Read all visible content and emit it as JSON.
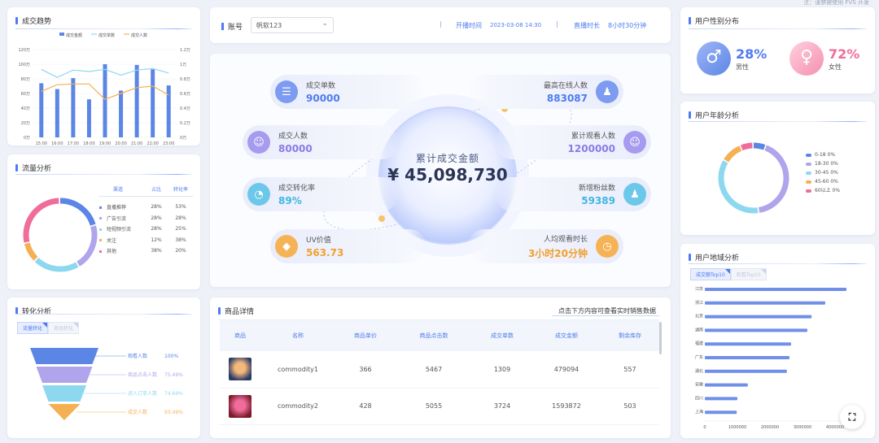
{
  "note": "注：谨禁被使用 FVS 开发",
  "trend": {
    "title": "成交趋势",
    "legend": [
      "成交金额",
      "成交单数",
      "成交人数"
    ],
    "yleft": [
      "120万",
      "100万",
      "80万",
      "60万",
      "40万",
      "20万",
      "0万"
    ],
    "yright": [
      "1.2万",
      "1万",
      "0.8万",
      "0.6万",
      "0.4万",
      "0.2万",
      "0万"
    ],
    "x": [
      "15:00",
      "16:00",
      "17:00",
      "18:00",
      "19:00",
      "20:00",
      "21:00",
      "22:00",
      "23:00"
    ]
  },
  "chart_data": [
    {
      "type": "bar",
      "title": "成交趋势",
      "categories": [
        "15:00",
        "16:00",
        "17:00",
        "18:00",
        "19:00",
        "20:00",
        "21:00",
        "22:00",
        "23:00"
      ],
      "series": [
        {
          "name": "成交金额",
          "type": "bar",
          "values": [
            74,
            66,
            81,
            52,
            100,
            64,
            99,
            93,
            71
          ]
        },
        {
          "name": "成交单数",
          "type": "line",
          "values": [
            0.93,
            0.82,
            0.92,
            0.9,
            0.93,
            0.85,
            0.92,
            0.94,
            0.88
          ]
        },
        {
          "name": "成交人数",
          "type": "line",
          "values": [
            0.63,
            0.72,
            0.73,
            0.73,
            0.52,
            0.6,
            0.68,
            0.7,
            0.58
          ]
        }
      ],
      "ylim_left": [
        0,
        120
      ],
      "ylim_right": [
        0,
        1.2
      ]
    },
    {
      "type": "pie",
      "title": "流量分析",
      "categories": [
        "直播推荐",
        "广告引流",
        "短视频引流",
        "关注",
        "其他"
      ],
      "values": [
        28,
        28,
        28,
        12,
        38
      ],
      "colors": [
        "#5b86e5",
        "#b0a4ec",
        "#8ed8ef",
        "#f6b054",
        "#f06c9b"
      ]
    },
    {
      "type": "pie",
      "title": "用户年龄分析",
      "categories": [
        "0-18",
        "18-30",
        "30-45",
        "45-60",
        "60以上"
      ],
      "values": [
        6,
        42,
        36,
        10,
        6
      ],
      "colors": [
        "#5b86e5",
        "#b0a4ec",
        "#8ed8ef",
        "#f6b054",
        "#f06c9b"
      ]
    },
    {
      "type": "bar",
      "title": "用户地域分析",
      "categories": [
        "江苏",
        "浙江",
        "北京",
        "湖南",
        "福建",
        "广东",
        "湖北",
        "安徽",
        "四川",
        "上海"
      ],
      "values": [
        4350000,
        3700000,
        3280000,
        3150000,
        2650000,
        2600000,
        2520000,
        1320000,
        1000000,
        980000
      ],
      "xlim": [
        0,
        4500000
      ],
      "xticks": [
        "0",
        "1000000",
        "2000000",
        "3000000",
        "4000000"
      ]
    }
  ],
  "flow": {
    "title": "流量分析",
    "headers": [
      "渠道",
      "占比",
      "转化率"
    ],
    "rows": [
      {
        "name": "直播推荐",
        "pct": "28%",
        "conv": "53%",
        "color": "#5b86e5"
      },
      {
        "name": "广告引流",
        "pct": "28%",
        "conv": "28%",
        "color": "#b0a4ec"
      },
      {
        "name": "短视频引流",
        "pct": "28%",
        "conv": "25%",
        "color": "#8ed8ef"
      },
      {
        "name": "关注",
        "pct": "12%",
        "conv": "38%",
        "color": "#f6b054"
      },
      {
        "name": "其他",
        "pct": "38%",
        "conv": "20%",
        "color": "#f06c9b"
      }
    ]
  },
  "conversion": {
    "title": "转化分析",
    "tabs": [
      "流量转化",
      "商品转化"
    ],
    "stages": [
      {
        "label": "观看人数",
        "pct": "100%",
        "color": "#5b86e5"
      },
      {
        "label": "商品点击人数",
        "pct": "75.49%",
        "color": "#b0a4ec"
      },
      {
        "label": "进入订单人数",
        "pct": "74.69%",
        "color": "#8ed8ef"
      },
      {
        "label": "成交人数",
        "pct": "93.49%",
        "color": "#f6b054"
      }
    ]
  },
  "header": {
    "account_label": "账号",
    "account_value": "帆软123",
    "start_label": "开播时间",
    "start_value": "2023-03-08 14:30",
    "duration_label": "直播时长",
    "duration_value": "8小时30分钟"
  },
  "center": {
    "total_label": "累计成交金额",
    "total_value": "¥ 45,098,730",
    "stats_left": [
      {
        "label": "成交单数",
        "value": "90000",
        "color": "#4e7bef",
        "icon": "clipboard-icon",
        "glyph": "☰",
        "bg": "#7d9bf0"
      },
      {
        "label": "成交人数",
        "value": "80000",
        "color": "#8c7ae6",
        "icon": "group-icon",
        "glyph": "☺",
        "bg": "#a69bef"
      },
      {
        "label": "成交转化率",
        "value": "89%",
        "color": "#3fb6e0",
        "icon": "chart-circle-icon",
        "glyph": "◔",
        "bg": "#6cc8ea"
      },
      {
        "label": "UV价值",
        "value": "563.73",
        "color": "#f0a030",
        "icon": "diamond-icon",
        "glyph": "◆",
        "bg": "#f6b355"
      }
    ],
    "stats_right": [
      {
        "label": "最高在线人数",
        "value": "883087",
        "color": "#4e7bef",
        "icon": "user-online-icon",
        "glyph": "♟",
        "bg": "#7d9bf0"
      },
      {
        "label": "累计观看人数",
        "value": "1200000",
        "color": "#8c7ae6",
        "icon": "viewers-icon",
        "glyph": "☺",
        "bg": "#a69bef"
      },
      {
        "label": "新增粉丝数",
        "value": "59389",
        "color": "#3fb6e0",
        "icon": "new-fan-icon",
        "glyph": "♟",
        "bg": "#6cc8ea"
      },
      {
        "label": "人均观看时长",
        "value": "3小时20分钟",
        "color": "#f0a030",
        "icon": "clock-icon",
        "glyph": "◷",
        "bg": "#f6b355"
      }
    ]
  },
  "products": {
    "title": "商品详情",
    "hint": "点击下方内容可查看实时销售数据",
    "headers": [
      "商品",
      "名称",
      "商品单价",
      "商品点击数",
      "成交单数",
      "成交金额",
      "剩余库存"
    ],
    "rows": [
      {
        "name": "commodity1",
        "price": "366",
        "clicks": "5467",
        "orders": "1309",
        "amount": "479094",
        "stock": "557"
      },
      {
        "name": "commodity2",
        "price": "428",
        "clicks": "5055",
        "orders": "3724",
        "amount": "1593872",
        "stock": "503"
      }
    ]
  },
  "gender": {
    "title": "用户性别分布",
    "male_pct": "28%",
    "male_label": "男性",
    "female_pct": "72%",
    "female_label": "女性"
  },
  "age": {
    "title": "用户年龄分析",
    "items": [
      {
        "label": "0-18",
        "pct": "0%",
        "color": "#5b86e5"
      },
      {
        "label": "18-30",
        "pct": "0%",
        "color": "#b0a4ec"
      },
      {
        "label": "30-45",
        "pct": "0%",
        "color": "#8ed8ef"
      },
      {
        "label": "45-60",
        "pct": "0%",
        "color": "#f6b054"
      },
      {
        "label": "60以上",
        "pct": "0%",
        "color": "#f06c9b"
      }
    ]
  },
  "region": {
    "title": "用户地域分析",
    "tabs": [
      "成交额Top10",
      "观看Top10"
    ]
  }
}
